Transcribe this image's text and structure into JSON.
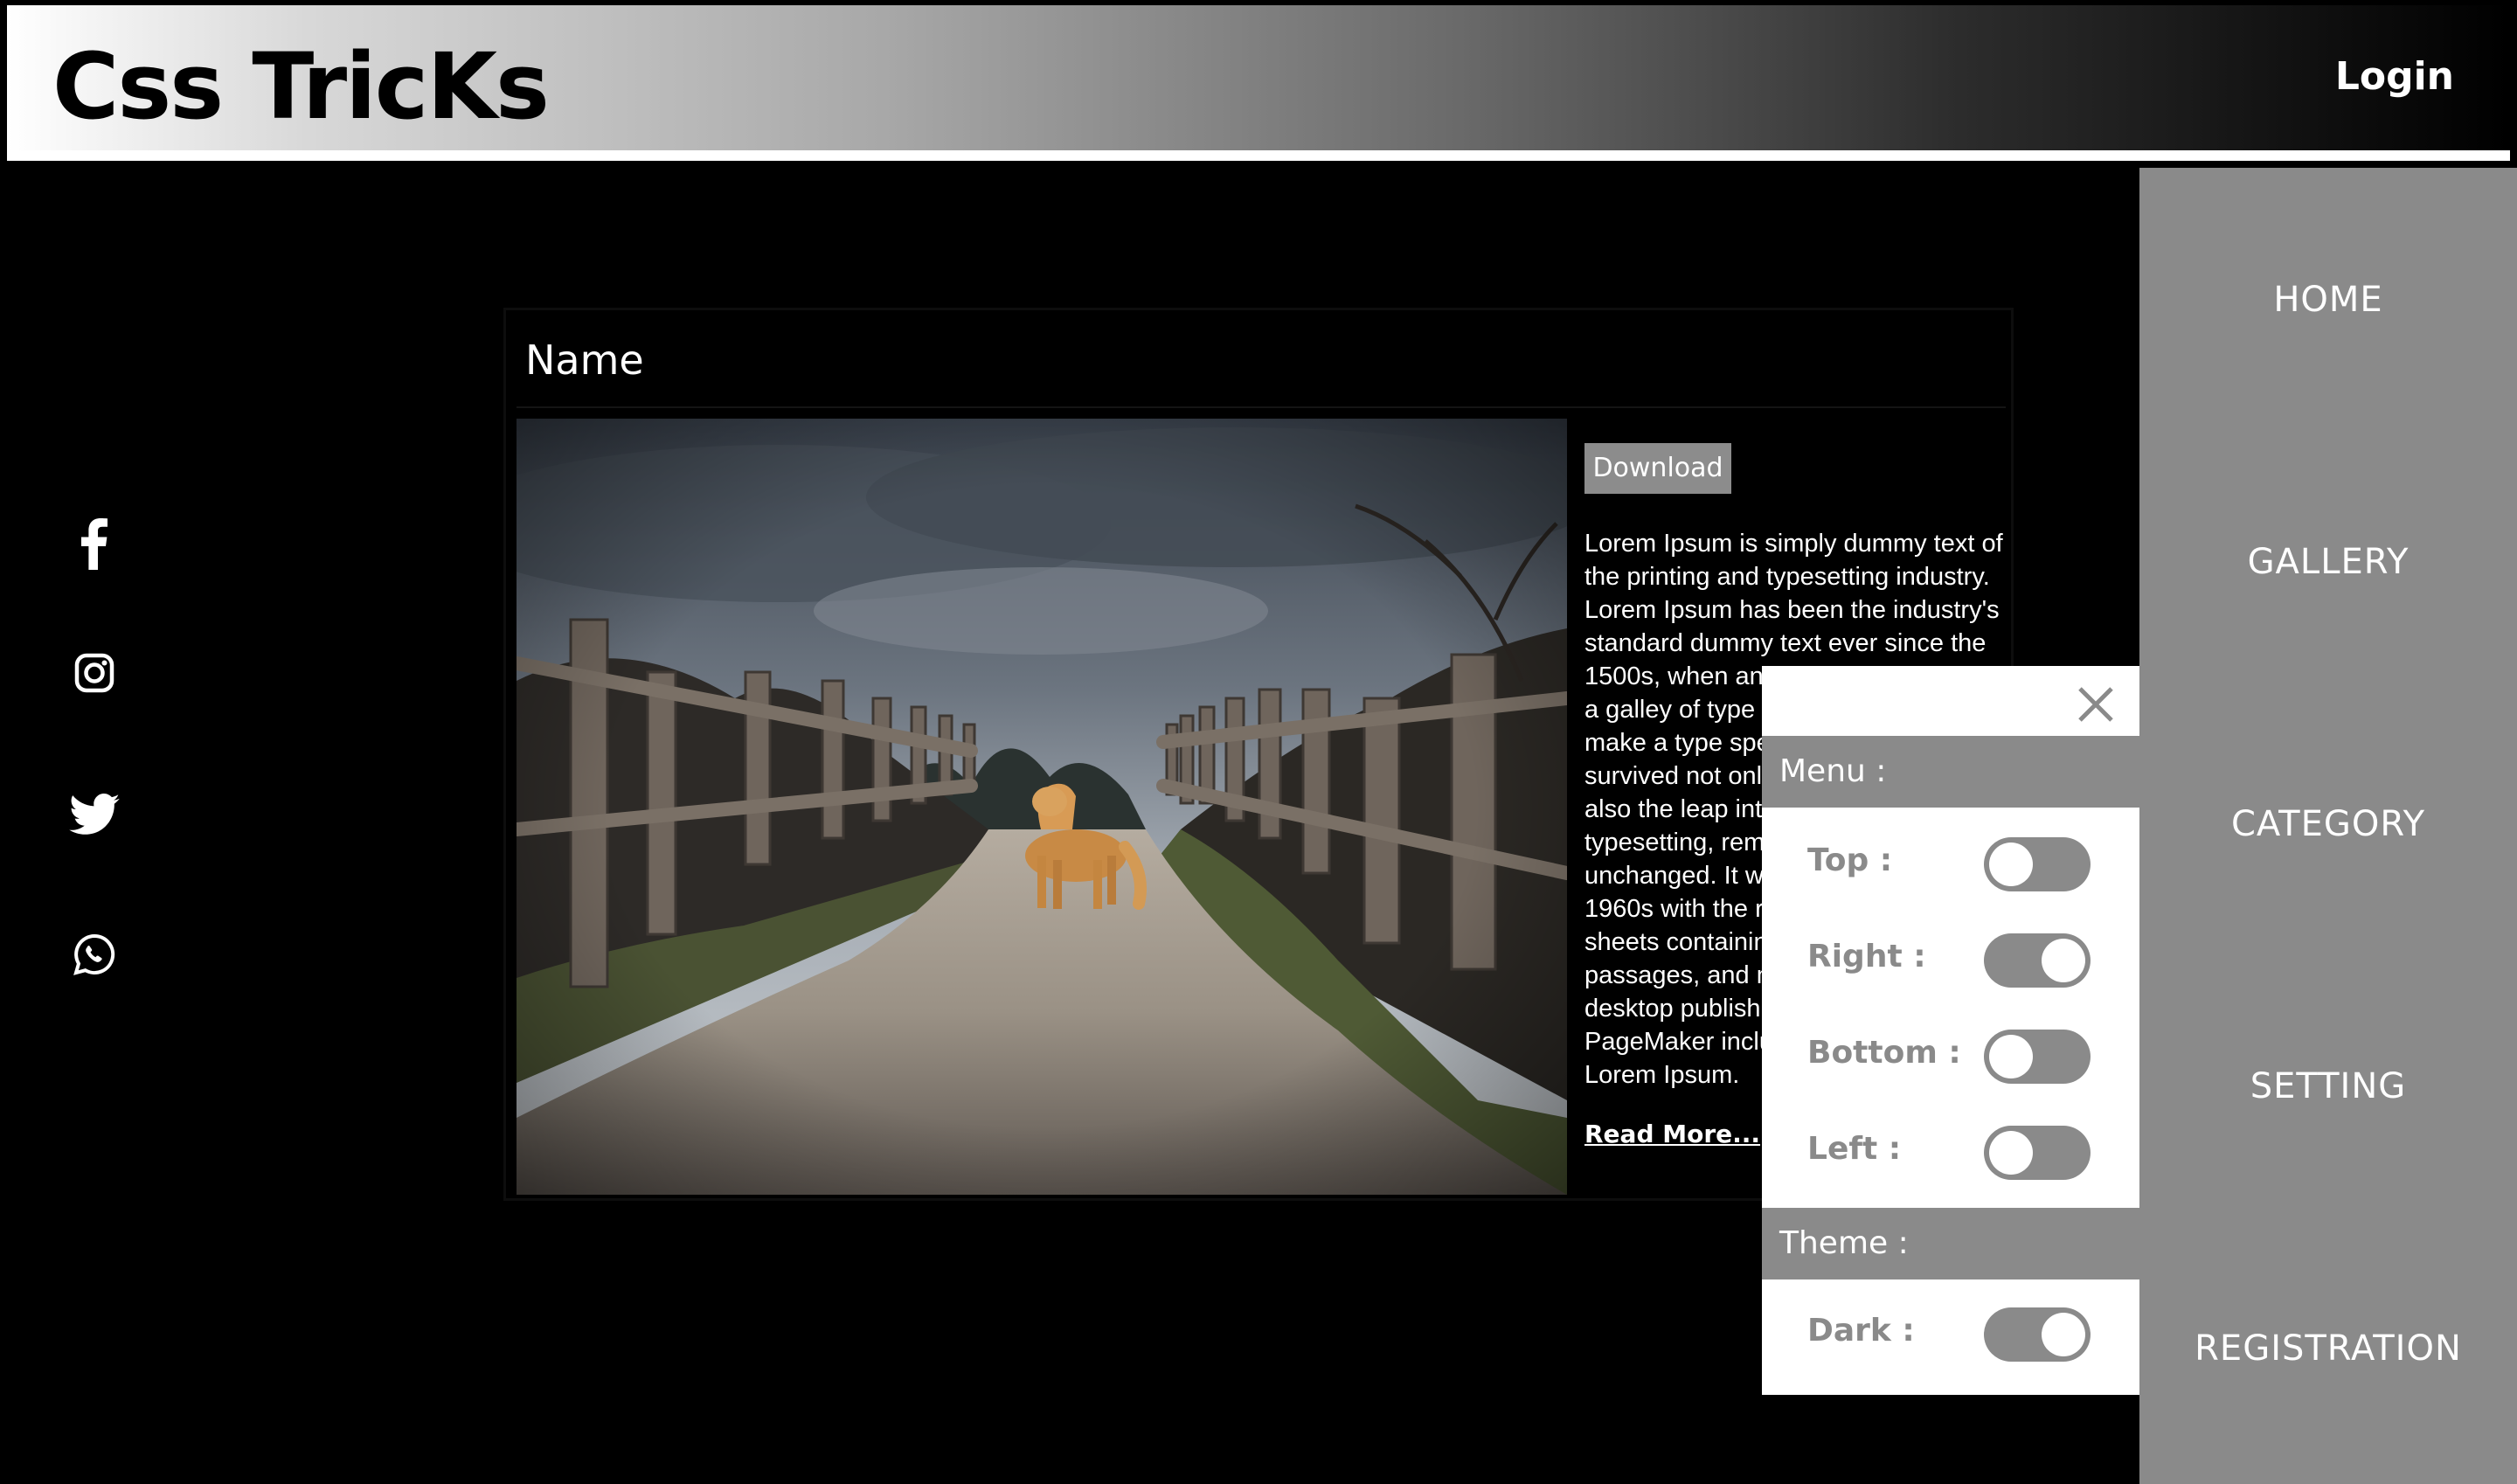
{
  "header": {
    "logo": "Css TricKs",
    "login": "Login"
  },
  "social": [
    {
      "icon": "facebook-icon"
    },
    {
      "icon": "instagram-icon"
    },
    {
      "icon": "twitter-icon"
    },
    {
      "icon": "whatsapp-icon"
    }
  ],
  "nav": {
    "items": [
      {
        "label": "HOME"
      },
      {
        "label": "GALLERY"
      },
      {
        "label": "CATEGORY"
      },
      {
        "label": "SETTING"
      },
      {
        "label": "REGISTRATION"
      }
    ]
  },
  "card": {
    "title": "Name",
    "download_label": "Download",
    "description": "Lorem Ipsum is simply dummy text of the printing and typesetting industry. Lorem Ipsum has been the industry's standard dummy text ever since the 1500s, when an u",
    "description_parts": [
      "Lorem Ipsum is simply dummy text of",
      "the printing and typesetting industry.",
      "Lorem Ipsum has been the industry's",
      "standard dummy text ever since the",
      "1500s, when an u",
      "a galley of type a",
      "make a type spec",
      "survived not only",
      "also the leap into",
      "typesetting, rem",
      "unchanged. It wa",
      "1960s with the re",
      "sheets containin",
      "passages, and m",
      "desktop publishi",
      "PageMaker inclu",
      "Lorem Ipsum."
    ],
    "read_more": "Read More...",
    "image_subject": "dog-on-path-photo"
  },
  "settings": {
    "close_icon": "close-icon",
    "menu_heading": "Menu :",
    "menu_options": [
      {
        "label": "Top :",
        "on": false
      },
      {
        "label": "Right :",
        "on": true
      },
      {
        "label": "Bottom :",
        "on": false
      },
      {
        "label": "Left :",
        "on": false
      }
    ],
    "theme_heading": "Theme :",
    "theme_options": [
      {
        "label": "Dark :",
        "on": true
      }
    ]
  },
  "colors": {
    "background": "#000000",
    "nav_gray": "#8a8a8a",
    "panel_white": "#ffffff",
    "text_white": "#ffffff"
  }
}
